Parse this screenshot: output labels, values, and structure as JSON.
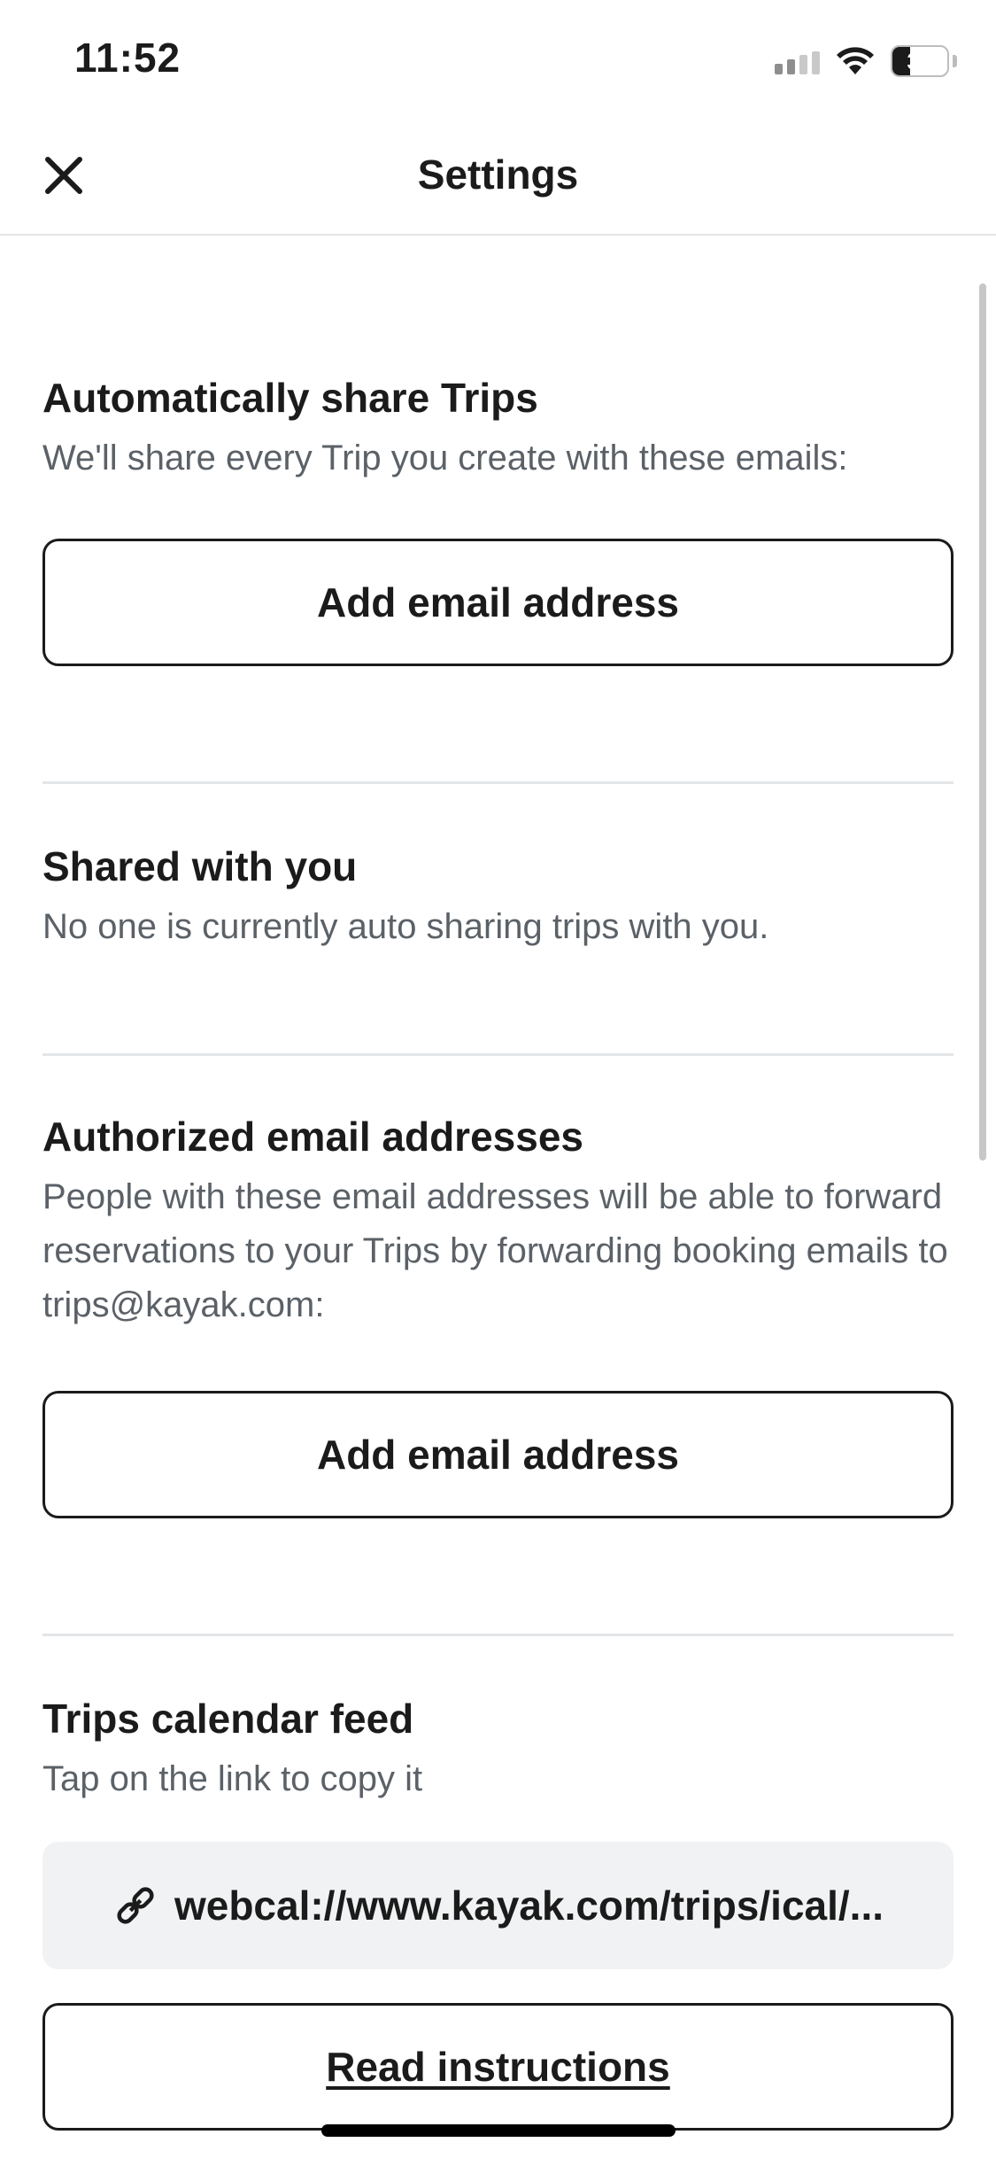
{
  "status_bar": {
    "time": "11:52",
    "battery_level": "33",
    "battery_fraction": 0.33,
    "icons": [
      "cellular-signal-icon",
      "wifi-icon",
      "battery-icon"
    ]
  },
  "header": {
    "title": "Settings",
    "close_icon": "close-icon"
  },
  "sections": {
    "auto_share": {
      "title": "Automatically share Trips",
      "description": "We'll share every Trip you create with these emails:",
      "button_label": "Add email address"
    },
    "shared_with_you": {
      "title": "Shared with you",
      "description": "No one is currently auto sharing trips with you."
    },
    "authorized_emails": {
      "title": "Authorized email addresses",
      "description": "People with these email addresses will be able to forward reservations to your Trips by forwarding booking emails to trips@kayak.com:",
      "button_label": "Add email address"
    },
    "calendar_feed": {
      "title": "Trips calendar feed",
      "description": "Tap on the link to copy it",
      "link_text": "webcal://www.kayak.com/trips/ical/...",
      "link_icon": "link-icon",
      "instructions_label": "Read instructions"
    }
  },
  "colors": {
    "text": "#1b1b1b",
    "muted_text": "#5b6167",
    "divider": "#e3e6e8",
    "link_box_bg": "#f0f2f3"
  }
}
